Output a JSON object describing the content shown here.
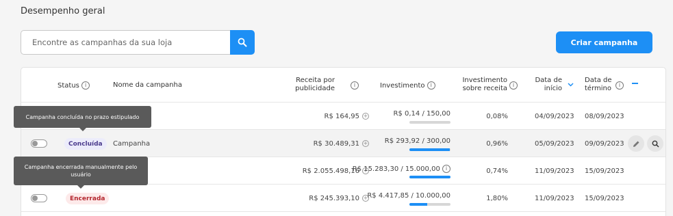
{
  "page": {
    "section_title": "Desempenho geral",
    "search_placeholder": "Encontre as campanhas da sua loja",
    "create_button": "Criar campanha"
  },
  "colors": {
    "accent": "#1d8ff5",
    "concluded_badge": "#4a3a8c",
    "ended_badge": "#b3262e"
  },
  "table": {
    "headers": {
      "status": "Status",
      "name": "Nome da campanha",
      "revenue": "Receita por publicidade",
      "investment": "Investimento",
      "roas": "Investimento sobre receita",
      "start": "Data de início",
      "end": "Data de término"
    },
    "rows": [
      {
        "status": "",
        "name": "",
        "revenue": "R$ 164,95",
        "investment": "R$ 0,14 / 150,00",
        "progress": 0.001,
        "roas": "0,08%",
        "start": "04/09/2023",
        "end": "08/09/2023"
      },
      {
        "status": "Concluída",
        "name": "Campanha",
        "revenue": "R$ 30.489,31",
        "investment": "R$ 293,92 / 300,00",
        "progress": 0.98,
        "roas": "0,96%",
        "start": "05/09/2023",
        "end": "09/09/2023"
      },
      {
        "status": "",
        "name": "",
        "revenue": "R$ 2.055.498,16",
        "investment": "R$ 15.283,30 / 15.000,00",
        "progress": 1.0,
        "roas": "0,74%",
        "start": "11/09/2023",
        "end": "15/09/2023"
      },
      {
        "status": "Encerrada",
        "name": "",
        "revenue": "R$ 245.393,10",
        "investment": "R$ 4.417,85 / 10.000,00",
        "progress": 0.44,
        "roas": "1,80%",
        "start": "11/09/2023",
        "end": "15/09/2023"
      }
    ]
  },
  "tooltips": {
    "concluded": "Campanha concluída no prazo estipulado",
    "ended": "Campanha encerrada manualmente pelo usuário"
  },
  "icons": {
    "search": "search-icon",
    "info": "info-icon",
    "sort": "chevron-down-icon",
    "edit": "pencil-icon",
    "details": "search-icon",
    "add": "plus-circle-icon"
  }
}
